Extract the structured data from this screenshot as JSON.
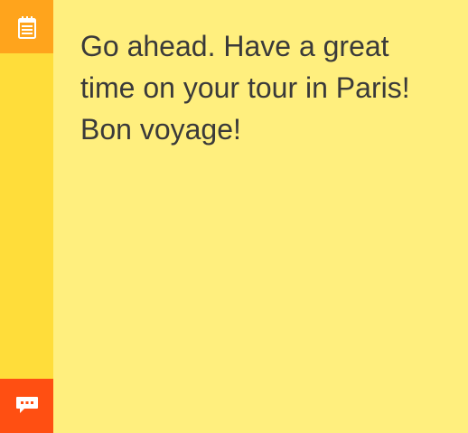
{
  "note": {
    "text": "Go ahead. Have a great time on your tour in Paris! Bon voyage!"
  },
  "sidebar": {
    "top_icon": "notepad-icon",
    "bottom_icon": "comment-icon"
  },
  "colors": {
    "sidebar": "#FFDD3A",
    "top_button": "#FFA41C",
    "bottom_button": "#FF4F12",
    "note_background": "#FFEF7E",
    "text": "#3A3A3A"
  }
}
